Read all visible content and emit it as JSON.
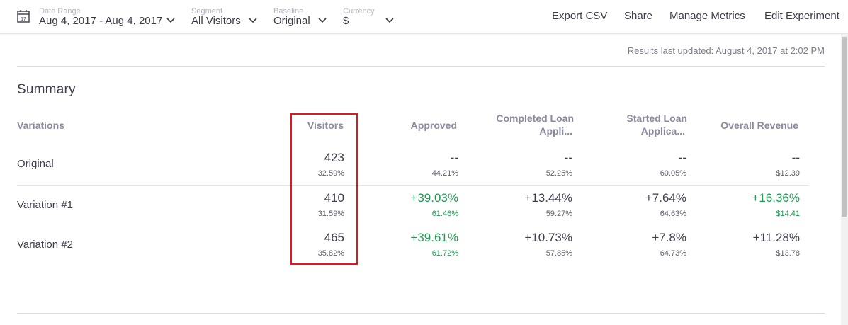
{
  "toolbar": {
    "date_range": {
      "label": "Date Range",
      "value": "Aug 4, 2017 - Aug 4, 2017",
      "calendar_day": "17"
    },
    "segment": {
      "label": "Segment",
      "value": "All Visitors"
    },
    "baseline": {
      "label": "Baseline",
      "value": "Original"
    },
    "currency": {
      "label": "Currency",
      "value": "$"
    },
    "actions": [
      "Export CSV",
      "Share",
      "Manage Metrics",
      "Edit Experiment"
    ]
  },
  "results_updated": "Results last updated: August 4, 2017 at 2:02 PM",
  "summary": {
    "title": "Summary",
    "columns": {
      "variations": "Variations",
      "visitors": "Visitors",
      "approved": "Approved",
      "completed_1": "Completed Loan",
      "completed_2": "Appli...",
      "started_1": "Started Loan",
      "started_2": "Applica...",
      "revenue": "Overall Revenue"
    },
    "rows": [
      {
        "name": "Original",
        "visitors": "423",
        "visitors_pct": "32.59%",
        "approved": "--",
        "approved_sub": "44.21%",
        "completed": "--",
        "completed_sub": "52.25%",
        "started": "--",
        "started_sub": "60.05%",
        "revenue": "--",
        "revenue_sub": "$12.39"
      },
      {
        "name": "Variation #1",
        "visitors": "410",
        "visitors_pct": "31.59%",
        "approved": "+39.03%",
        "approved_sub": "61.46%",
        "completed": "+13.44%",
        "completed_sub": "59.27%",
        "started": "+7.64%",
        "started_sub": "64.63%",
        "revenue": "+16.36%",
        "revenue_sub": "$14.41"
      },
      {
        "name": "Variation #2",
        "visitors": "465",
        "visitors_pct": "35.82%",
        "approved": "+39.61%",
        "approved_sub": "61.72%",
        "completed": "+10.73%",
        "completed_sub": "57.85%",
        "started": "+7.8%",
        "started_sub": "64.73%",
        "revenue": "+11.28%",
        "revenue_sub": "$13.78"
      }
    ]
  },
  "colors": {
    "positive": "#229954",
    "highlight": "#e0191e",
    "text": "#3d3d4e",
    "header": "#8a8aa0"
  }
}
